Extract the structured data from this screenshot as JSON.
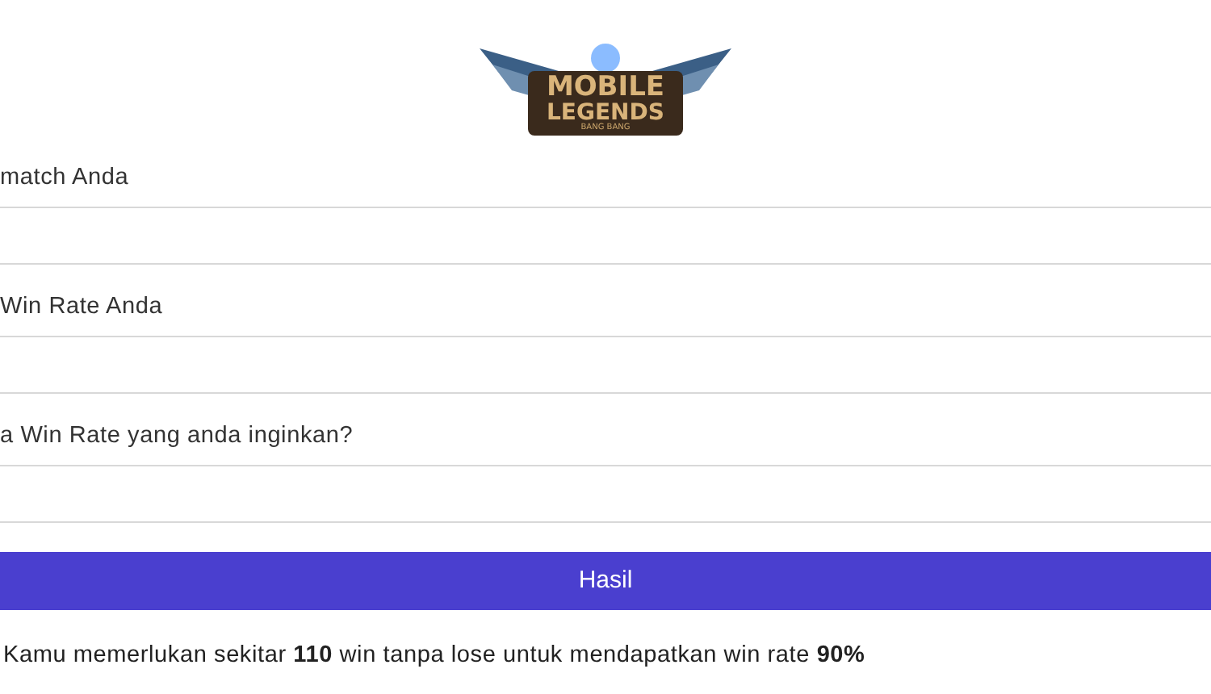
{
  "logo": {
    "line_1": "MOBILE",
    "line_2": "LEGENDS",
    "line_3": "BANG BANG"
  },
  "fields": [
    {
      "label": "match Anda"
    },
    {
      "label": "Win Rate Anda"
    },
    {
      "label": "a Win Rate yang anda inginkan?"
    }
  ],
  "button": "Hasil",
  "result": "Kamu memerlukan sekitar **110** win tanpa lose untuk mendapatkan win rate **90%**"
}
